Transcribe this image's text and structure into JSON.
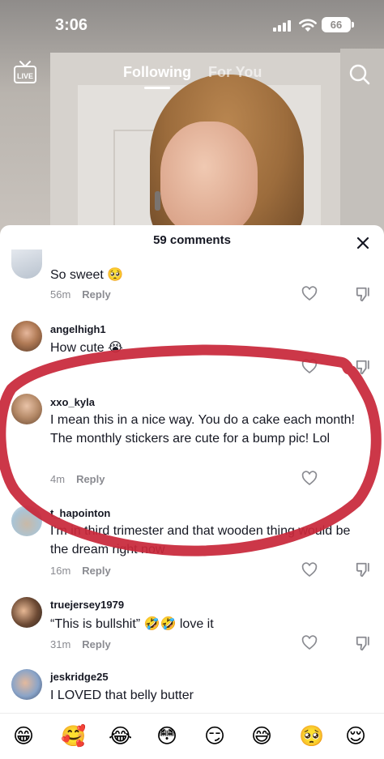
{
  "status_bar": {
    "time": "3:06",
    "battery": "66"
  },
  "nav": {
    "live_label": "LIVE",
    "tab_following": "Following",
    "tab_foryou": "For You"
  },
  "comments_header": {
    "title": "59 comments"
  },
  "comments": [
    {
      "username": "",
      "text": "So sweet 🥺",
      "time": "56m",
      "reply": "Reply"
    },
    {
      "username": "angelhigh1",
      "text": "How cute 😭",
      "time": "",
      "reply": ""
    },
    {
      "username": "xxo_kyla",
      "text": "I mean this in a nice way. You do a cake each month! The monthly stickers are cute for a bump pic! Lol",
      "time": "4m",
      "reply": "Reply"
    },
    {
      "username": "t_hapointon",
      "text": "I'm in third trimester and that wooden thing would be the dream right now",
      "time": "16m",
      "reply": "Reply"
    },
    {
      "username": "truejersey1979",
      "text": "“This is bullshit” 🤣🤣 love it",
      "time": "31m",
      "reply": "Reply"
    },
    {
      "username": "jeskridge25",
      "text": "I LOVED that belly butter",
      "time": "",
      "reply": ""
    }
  ],
  "emoji_bar": [
    "😁",
    "🥰",
    "😂",
    "😳",
    "😏",
    "😅",
    "🥺",
    "😌"
  ],
  "colors": {
    "scribble": "#c8283a",
    "text": "#161823",
    "meta": "#8a8b91"
  }
}
